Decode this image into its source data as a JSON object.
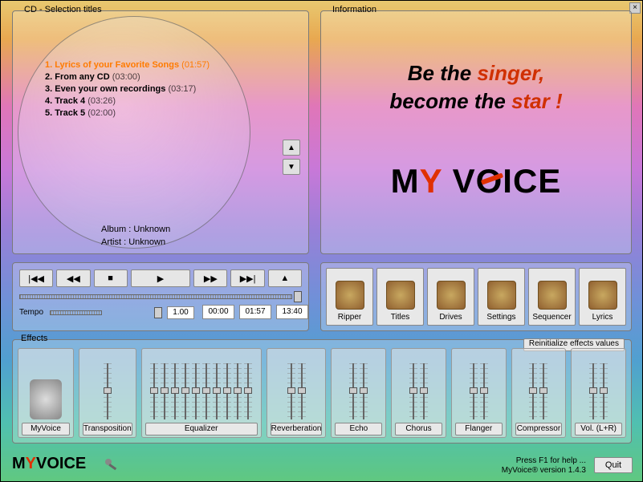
{
  "close_x": "×",
  "cd": {
    "title": "CD - Selection titles",
    "tracks": [
      {
        "num": "1.",
        "name": "Lyrics of your Favorite Songs",
        "dur": "(01:57)",
        "selected": true
      },
      {
        "num": "2.",
        "name": "From any CD",
        "dur": "(03:00)",
        "selected": false
      },
      {
        "num": "3.",
        "name": "Even your own recordings",
        "dur": "(03:17)",
        "selected": false
      },
      {
        "num": "4.",
        "name": "Track 4",
        "dur": "(03:26)",
        "selected": false
      },
      {
        "num": "5.",
        "name": "Track 5",
        "dur": "(02:00)",
        "selected": false
      }
    ],
    "scroll_up": "▲",
    "scroll_down": "▼",
    "album": "Album : Unknown",
    "artist": "Artist : Unknown"
  },
  "info": {
    "title": "Information",
    "line1a": "Be the ",
    "line1b": "singer,",
    "line2a": "become the ",
    "line2b": "star !",
    "logo_pre": "M",
    "logo_y": "Y",
    "logo_mid": " V",
    "logo_o": "O",
    "logo_post": "ICE"
  },
  "transport": {
    "prev": "|◀◀",
    "rew": "◀◀",
    "stop": "■",
    "play": "▶",
    "ff": "▶▶",
    "next": "▶▶|",
    "eject": "▲",
    "tempo_label": "Tempo",
    "tempo_value": "1.00",
    "t_elapsed": "00:00",
    "t_track": "01:57",
    "t_total": "13:40"
  },
  "tools": {
    "items": [
      {
        "name": "ripper",
        "label": "Ripper"
      },
      {
        "name": "titles",
        "label": "Titles"
      },
      {
        "name": "drives",
        "label": "Drives"
      },
      {
        "name": "settings",
        "label": "Settings"
      },
      {
        "name": "sequencer",
        "label": "Sequencer"
      },
      {
        "name": "lyrics",
        "label": "Lyrics"
      }
    ]
  },
  "effects": {
    "title": "Effects",
    "reinit": "Reinitialize effects values",
    "items": [
      {
        "name": "myvoice",
        "label": "MyVoice",
        "sliders": 1,
        "icon": true
      },
      {
        "name": "transposition",
        "label": "Transposition",
        "sliders": 1
      },
      {
        "name": "equalizer",
        "label": "Equalizer",
        "sliders": 10
      },
      {
        "name": "reverb",
        "label": "Reverberation",
        "sliders": 2
      },
      {
        "name": "echo",
        "label": "Echo",
        "sliders": 2
      },
      {
        "name": "chorus",
        "label": "Chorus",
        "sliders": 2
      },
      {
        "name": "flanger",
        "label": "Flanger",
        "sliders": 2
      },
      {
        "name": "compressor",
        "label": "Compressor",
        "sliders": 2
      },
      {
        "name": "volume",
        "label": "Vol. (L+R)",
        "sliders": 2
      }
    ]
  },
  "footer": {
    "logo_pre": "M",
    "logo_y": "Y",
    "logo_post": "VOICE",
    "help": "Press F1 for help ...",
    "version": "MyVoice® version 1.4.3",
    "quit": "Quit"
  }
}
